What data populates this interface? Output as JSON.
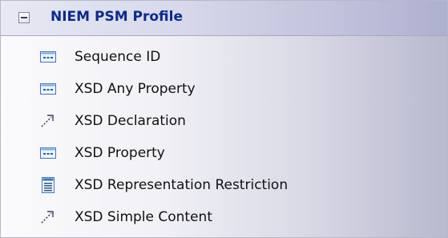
{
  "profile": {
    "title": "NIEM PSM Profile",
    "collapse_icon": "minus-box-icon"
  },
  "items": [
    {
      "label": "Sequence ID",
      "icon": "attribute-icon"
    },
    {
      "label": "XSD Any Property",
      "icon": "attribute-icon"
    },
    {
      "label": "XSD Declaration",
      "icon": "dashed-arrow-icon"
    },
    {
      "label": "XSD Property",
      "icon": "attribute-icon"
    },
    {
      "label": "XSD Representation Restriction",
      "icon": "class-list-icon"
    },
    {
      "label": "XSD Simple Content",
      "icon": "dashed-arrow-icon"
    }
  ],
  "colors": {
    "title": "#0b2a8c",
    "icon_blue": "#2f74c9"
  }
}
